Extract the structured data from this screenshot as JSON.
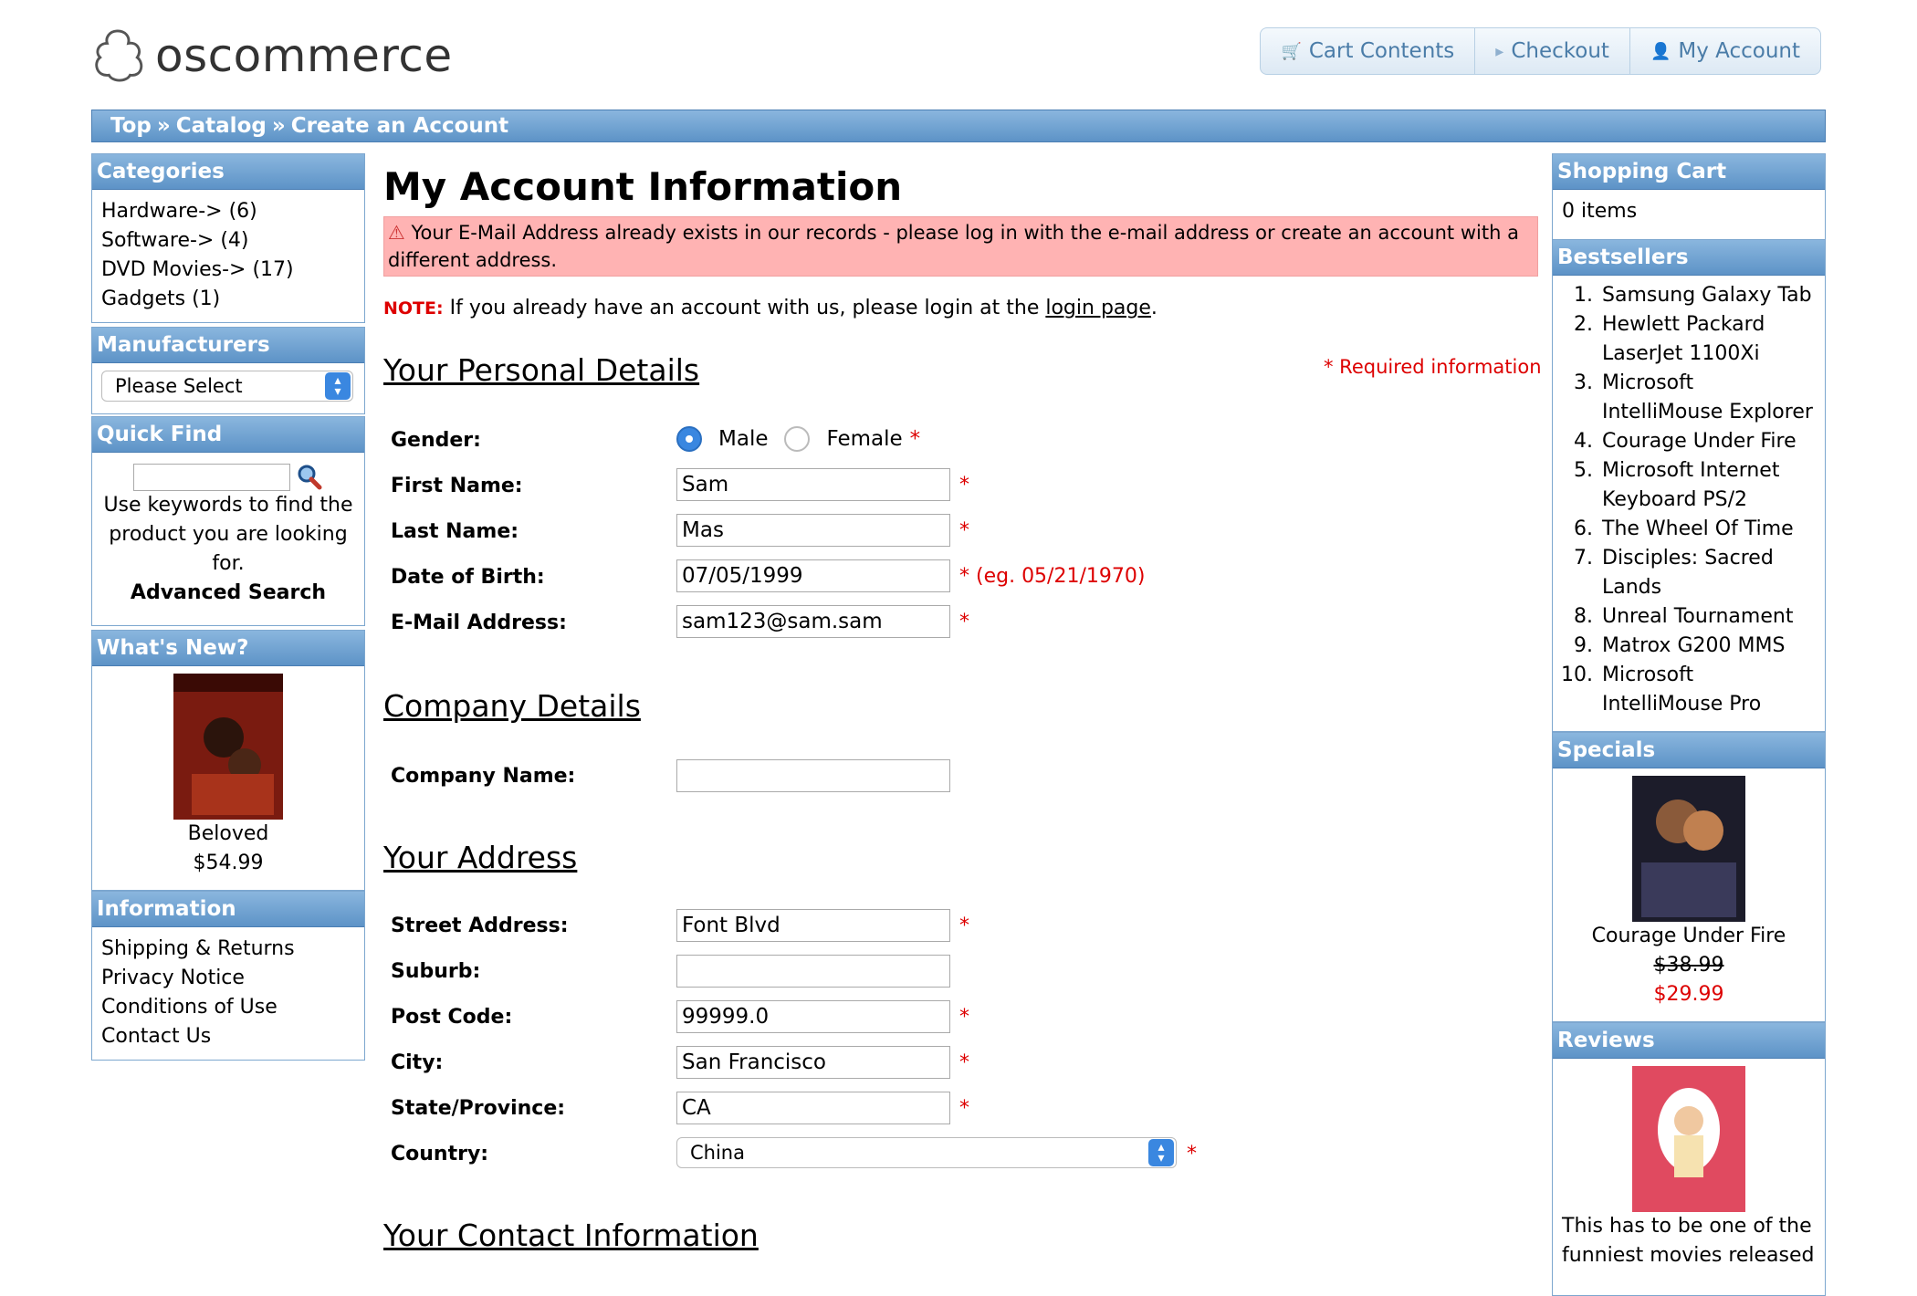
{
  "header": {
    "logo_text": "oscommerce",
    "buttons": [
      {
        "label": "Cart Contents",
        "icon": "cart-icon"
      },
      {
        "label": "Checkout",
        "icon": "triangle-right-icon"
      },
      {
        "label": "My Account",
        "icon": "user-icon"
      }
    ]
  },
  "breadcrumb": [
    "Top",
    "Catalog",
    "Create an Account"
  ],
  "categories": {
    "title": "Categories",
    "items": [
      "Hardware-> (6)",
      "Software-> (4)",
      "DVD Movies-> (17)",
      "Gadgets (1)"
    ]
  },
  "manufacturers": {
    "title": "Manufacturers",
    "selected": "Please Select"
  },
  "quick_find": {
    "title": "Quick Find",
    "help": "Use keywords to find the product you are looking for.",
    "advanced": "Advanced Search"
  },
  "whats_new": {
    "title": "What's New?",
    "product": "Beloved",
    "price": "$54.99"
  },
  "information": {
    "title": "Information",
    "items": [
      "Shipping & Returns",
      "Privacy Notice",
      "Conditions of Use",
      "Contact Us"
    ]
  },
  "shopping_cart": {
    "title": "Shopping Cart",
    "summary": "0 items"
  },
  "bestsellers": {
    "title": "Bestsellers",
    "items": [
      {
        "n": "1.",
        "lines": [
          "Samsung Galaxy Tab"
        ]
      },
      {
        "n": "2.",
        "lines": [
          "Hewlett Packard",
          "LaserJet 1100Xi"
        ]
      },
      {
        "n": "3.",
        "lines": [
          "Microsoft",
          "IntelliMouse Explorer"
        ]
      },
      {
        "n": "4.",
        "lines": [
          "Courage Under Fire"
        ]
      },
      {
        "n": "5.",
        "lines": [
          "Microsoft Internet",
          "Keyboard PS/2"
        ]
      },
      {
        "n": "6.",
        "lines": [
          "The Wheel Of Time"
        ]
      },
      {
        "n": "7.",
        "lines": [
          "Disciples: Sacred",
          "Lands"
        ]
      },
      {
        "n": "8.",
        "lines": [
          "Unreal Tournament"
        ]
      },
      {
        "n": "9.",
        "lines": [
          "Matrox G200 MMS"
        ]
      },
      {
        "n": "10.",
        "lines": [
          "Microsoft",
          "IntelliMouse Pro"
        ]
      }
    ]
  },
  "specials": {
    "title": "Specials",
    "product": "Courage Under Fire",
    "old_price": "$38.99",
    "new_price": "$29.99"
  },
  "reviews": {
    "title": "Reviews",
    "text": "This has to be one of the funniest movies released"
  },
  "main": {
    "title": "My Account Information",
    "error": "Your E-Mail Address already exists in our records - please log in with the e-mail address or create an account with a different address.",
    "note_label": "NOTE:",
    "note_text": "If you already have an account with us, please login at the",
    "note_link": "login page",
    "required_info": "* Required information",
    "personal": {
      "title": "Your Personal Details",
      "gender_label": "Gender:",
      "male": "Male",
      "female": "Female",
      "first_name_label": "First Name:",
      "first_name": "Sam",
      "last_name_label": "Last Name:",
      "last_name": "Mas",
      "dob_label": "Date of Birth:",
      "dob": "07/05/1999",
      "dob_hint": "* (eg. 05/21/1970)",
      "email_label": "E-Mail Address:",
      "email": "sam123@sam.sam"
    },
    "company": {
      "title": "Company Details",
      "name_label": "Company Name:",
      "name": ""
    },
    "address": {
      "title": "Your Address",
      "street_label": "Street Address:",
      "street": "Font Blvd",
      "suburb_label": "Suburb:",
      "suburb": "",
      "postcode_label": "Post Code:",
      "postcode": "99999.0",
      "city_label": "City:",
      "city": "San Francisco",
      "state_label": "State/Province:",
      "state": "CA",
      "country_label": "Country:",
      "country": "China"
    },
    "contact": {
      "title": "Your Contact Information"
    }
  }
}
